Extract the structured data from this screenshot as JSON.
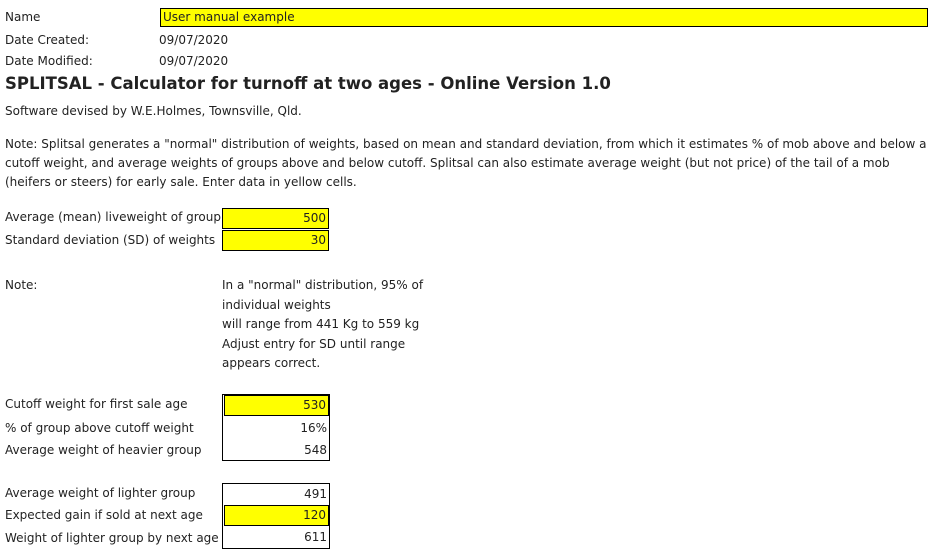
{
  "header": {
    "name_label": "Name",
    "name_value": "User manual example",
    "date_created_label": "Date Created:",
    "date_created_value": "09/07/2020",
    "date_modified_label": "Date Modified:",
    "date_modified_value": "09/07/2020"
  },
  "title": "SPLITSAL - Calculator for turnoff at two ages - Online Version 1.0",
  "author": "Software devised by W.E.Holmes, Townsville, Qld.",
  "intro_note": "Note: Splitsal generates a \"normal\" distribution of weights, based on mean and standard deviation, from which it estimates % of mob above and below a cutoff weight, and average weights of groups above and below cutoff. Splitsal can also estimate average weight (but not price) of the tail of a mob (heifers or steers) for early sale. Enter data in yellow cells.",
  "inputs": {
    "mean_label": "Average (mean) liveweight of group",
    "mean_value": "500",
    "sd_label": "Standard deviation (SD) of weights",
    "sd_value": "30"
  },
  "distribution_note": {
    "label": "Note:",
    "line1": "In a \"normal\" distribution, 95% of",
    "line2": "individual weights",
    "line3": "will range from 441 Kg to 559 kg",
    "line4": "Adjust entry for SD until range",
    "line5": "appears correct."
  },
  "cutoff": {
    "cutoff_label": "Cutoff weight for first sale age",
    "cutoff_value": "530",
    "pct_above_label": "% of group above cutoff weight",
    "pct_above_value": "16%",
    "heavier_label": "Average weight of heavier group",
    "heavier_value": "548"
  },
  "lighter": {
    "avg_label": "Average weight of lighter group",
    "avg_value": "491",
    "gain_label": "Expected gain if sold at next age",
    "gain_value": "120",
    "next_label": "Weight of lighter group by next age",
    "next_value": "611"
  },
  "colors": {
    "input_fill": "#ffff00",
    "border": "#000000",
    "text": "#222222"
  }
}
